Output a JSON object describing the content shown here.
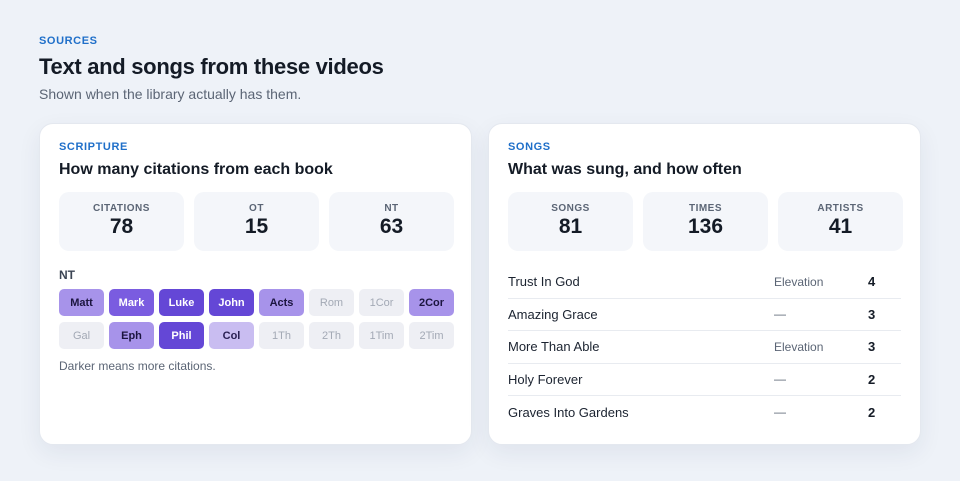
{
  "header": {
    "eyebrow": "SOURCES",
    "title": "Text and songs from these videos",
    "subtitle": "Shown when the library actually has them."
  },
  "scripture": {
    "eyebrow": "SCRIPTURE",
    "title": "How many citations from each book",
    "stats": [
      {
        "label": "CITATIONS",
        "value": "78"
      },
      {
        "label": "OT",
        "value": "15"
      },
      {
        "label": "NT",
        "value": "63"
      }
    ],
    "testament_label": "NT",
    "books": [
      {
        "name": "Matt",
        "level": 2
      },
      {
        "name": "Mark",
        "level": 3
      },
      {
        "name": "Luke",
        "level": 4
      },
      {
        "name": "John",
        "level": 4
      },
      {
        "name": "Acts",
        "level": 2
      },
      {
        "name": "Rom",
        "level": 0
      },
      {
        "name": "1Cor",
        "level": 0
      },
      {
        "name": "2Cor",
        "level": 2
      },
      {
        "name": "Gal",
        "level": 0
      },
      {
        "name": "Eph",
        "level": 2
      },
      {
        "name": "Phil",
        "level": 4
      },
      {
        "name": "Col",
        "level": 1
      },
      {
        "name": "1Th",
        "level": 0
      },
      {
        "name": "2Th",
        "level": 0
      },
      {
        "name": "1Tim",
        "level": 0
      },
      {
        "name": "2Tim",
        "level": 0
      }
    ],
    "legend_note": "Darker means more citations."
  },
  "songs": {
    "eyebrow": "SONGS",
    "title": "What was sung, and how often",
    "stats": [
      {
        "label": "SONGS",
        "value": "81"
      },
      {
        "label": "TIMES",
        "value": "136"
      },
      {
        "label": "ARTISTS",
        "value": "41"
      }
    ],
    "items": [
      {
        "title": "Trust In God",
        "artist": "Elevation",
        "count": "4"
      },
      {
        "title": "Amazing Grace",
        "artist": "—",
        "count": "3"
      },
      {
        "title": "More Than Able",
        "artist": "Elevation",
        "count": "3"
      },
      {
        "title": "Holy Forever",
        "artist": "—",
        "count": "2"
      },
      {
        "title": "Graves Into Gardens",
        "artist": "—",
        "count": "2"
      }
    ]
  }
}
